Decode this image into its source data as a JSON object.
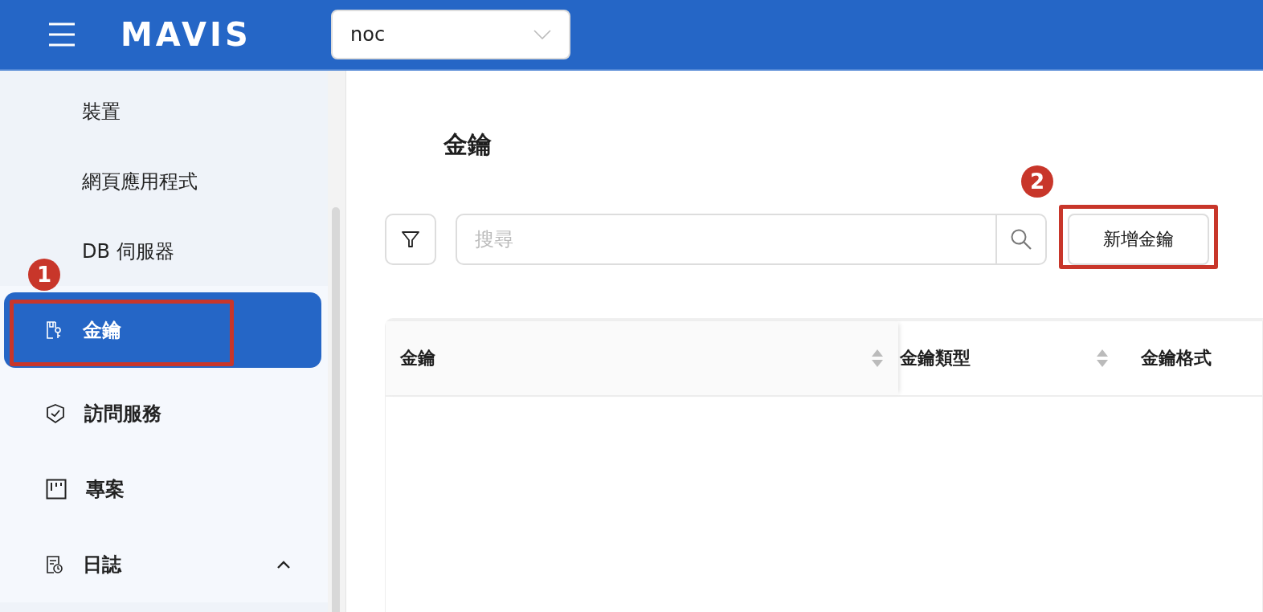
{
  "header": {
    "logo": "MAVIS",
    "project_select": {
      "value": "noc"
    }
  },
  "sidebar": {
    "items": [
      {
        "label": "裝置",
        "kind": "sub",
        "selected": false
      },
      {
        "label": "網頁應用程式",
        "kind": "sub",
        "selected": false
      },
      {
        "label": "DB 伺服器",
        "kind": "sub",
        "selected": false
      },
      {
        "label": "金鑰",
        "kind": "key",
        "selected": true
      },
      {
        "label": "訪問服務",
        "kind": "shield",
        "selected": false
      },
      {
        "label": "專案",
        "kind": "board",
        "selected": false
      },
      {
        "label": "日誌",
        "kind": "log",
        "selected": false,
        "expanded": true
      }
    ]
  },
  "page": {
    "title": "金鑰",
    "search": {
      "placeholder": "搜尋"
    },
    "add_button": "新增金鑰"
  },
  "table": {
    "columns": [
      {
        "label": "金鑰",
        "sortable": true
      },
      {
        "label": "金鑰類型",
        "sortable": true
      },
      {
        "label": "金鑰格式",
        "sortable": false
      }
    ]
  },
  "annotations": [
    {
      "label": "1"
    },
    {
      "label": "2"
    }
  ]
}
